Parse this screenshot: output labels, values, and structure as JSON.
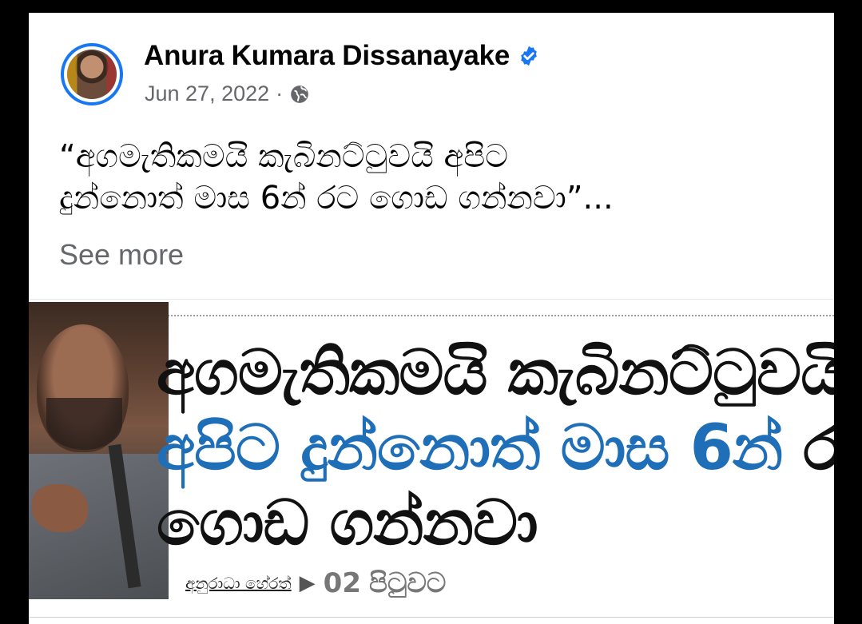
{
  "post": {
    "author": "Anura Kumara Dissanayake",
    "date": "Jun 27, 2022",
    "separator": "·",
    "text_line1": "“අගමැතිකමයි කැබිනට්ටුවයි අපිට",
    "text_line2": "දුන්නොත් මාස 6න් රට ගොඩ ගන්නවා”...",
    "see_more": "See more",
    "icons": {
      "verified": "verified-badge-icon",
      "audience": "globe-icon"
    },
    "accent_color": "#1877f2"
  },
  "news_image": {
    "headline_line1": "අගමැතිකමයි කැබිනට්ටුවයි",
    "headline_line2_blue": "අපිට දුන්නොත් මාස 6න්",
    "headline_line2_dark": "රට",
    "headline_line3": "ගොඩ ගන්නවා",
    "reporter": "අනුරාධා හේරත්",
    "page_number": "02",
    "page_label": "පිටුවට",
    "headline_blue_color": "#1f6fb8"
  }
}
